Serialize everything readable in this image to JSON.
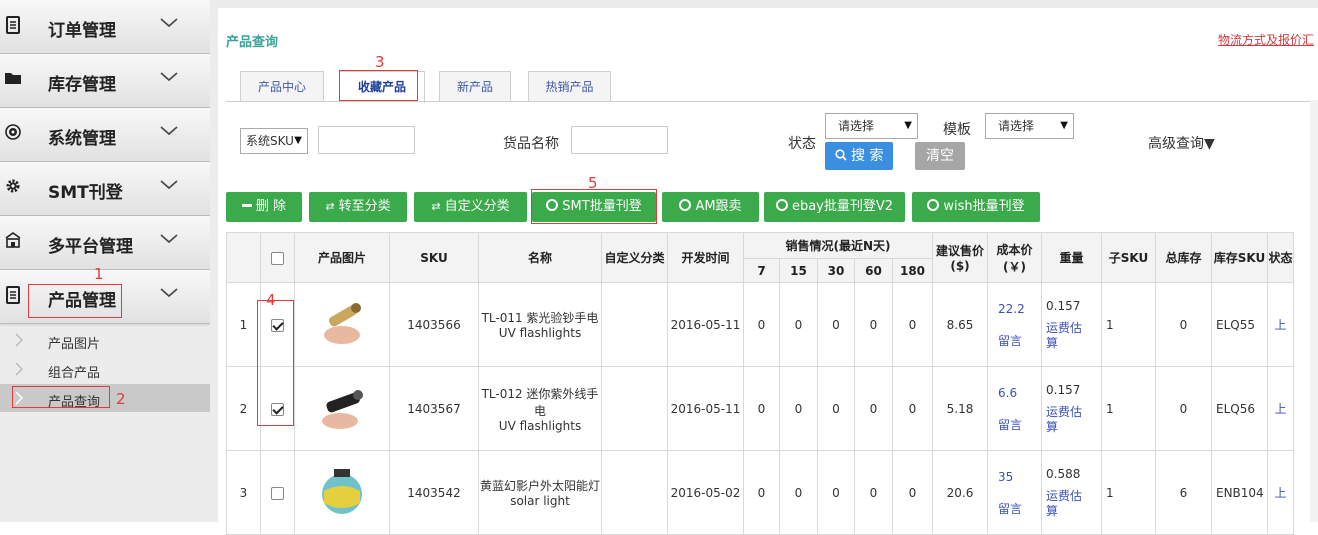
{
  "sidebar": {
    "menus": [
      {
        "label": "订单管理",
        "icon": "document-icon"
      },
      {
        "label": "库存管理",
        "icon": "folder-icon"
      },
      {
        "label": "系统管理",
        "icon": "target-icon"
      },
      {
        "label": "SMT刊登",
        "icon": "gear-icon"
      },
      {
        "label": "多平台管理",
        "icon": "building-icon"
      },
      {
        "label": "产品管理",
        "icon": "document-icon"
      }
    ],
    "subitems": [
      "产品图片",
      "组合产品",
      "产品查询"
    ]
  },
  "annotations": {
    "n1": "1",
    "n2": "2",
    "n3": "3",
    "n4": "4",
    "n5": "5"
  },
  "page": {
    "title": "产品查询",
    "link": "物流方式及报价汇"
  },
  "tabs": [
    "产品中心",
    "收藏产品",
    "新产品",
    "热销产品"
  ],
  "filters": {
    "sku_select": "系统SKU",
    "goods_name_label": "货品名称",
    "status_label": "状态",
    "status_select": "请选择",
    "template_label": "模板",
    "template_select": "请选择",
    "search_btn": "搜 索",
    "clear_btn": "清空",
    "advanced": "高级查询▼"
  },
  "actions": [
    "删 除",
    "转至分类",
    "自定义分类",
    "SMT批量刊登",
    "AM跟卖",
    "ebay批量刊登V2",
    "wish批量刊登"
  ],
  "table": {
    "headers": {
      "image": "产品图片",
      "sku": "SKU",
      "name": "名称",
      "custom": "自定义分类",
      "devtime": "开发时间",
      "sales": "销售情况(最近N天)",
      "price": "建议售价($)",
      "cost": "成本价(￥)",
      "weight": "重量",
      "subsku": "子SKU",
      "stock": "总库存",
      "stocksku": "库存SKU",
      "status": "状态"
    },
    "sales_days": [
      "7",
      "15",
      "30",
      "60",
      "180"
    ],
    "rows": [
      {
        "idx": "1",
        "checked": true,
        "sku": "1403566",
        "name1": "TL-011 紫光验钞手电",
        "name2": "UV flashlights",
        "date": "2016-05-11",
        "s7": "0",
        "s15": "0",
        "s30": "0",
        "s60": "0",
        "s180": "0",
        "price": "8.65",
        "cost": "22.2",
        "note": "留言",
        "weight": "0.157",
        "ship": "运费估算",
        "subsku": "1",
        "stock": "0",
        "stocksku": "ELQ55",
        "status": "上"
      },
      {
        "idx": "2",
        "checked": true,
        "sku": "1403567",
        "name1": "TL-012 迷你紫外线手电",
        "name2": "UV flashlights",
        "date": "2016-05-11",
        "s7": "0",
        "s15": "0",
        "s30": "0",
        "s60": "0",
        "s180": "0",
        "price": "5.18",
        "cost": "6.6",
        "note": "留言",
        "weight": "0.157",
        "ship": "运费估算",
        "subsku": "1",
        "stock": "0",
        "stocksku": "ELQ56",
        "status": "上"
      },
      {
        "idx": "3",
        "checked": false,
        "sku": "1403542",
        "name1": "黄蓝幻影户外太阳能灯",
        "name2": "solar light",
        "date": "2016-05-02",
        "s7": "0",
        "s15": "0",
        "s30": "0",
        "s60": "0",
        "s180": "0",
        "price": "20.6",
        "cost": "35",
        "note": "留言",
        "weight": "0.588",
        "ship": "运费估算",
        "subsku": "1",
        "stock": "6",
        "stocksku": "ENB104",
        "status": "上"
      }
    ]
  }
}
